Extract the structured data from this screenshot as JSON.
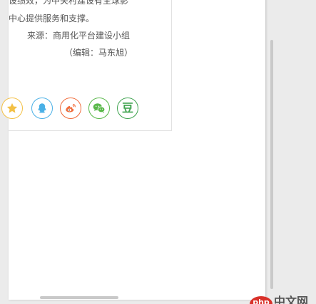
{
  "article": {
    "line1": "设绩效，为中关村建设有全球影",
    "line2": "中心提供服务和支撑。",
    "line3": "来源：商用化平台建设小组",
    "line4": "（编辑：马东旭）"
  },
  "share": {
    "buttons": [
      {
        "icon": "star-icon",
        "color": "#f3c044"
      },
      {
        "icon": "qq-icon",
        "color": "#4ab0e6"
      },
      {
        "icon": "weibo-icon",
        "color": "#f06c3b"
      },
      {
        "icon": "wechat-icon",
        "color": "#59b84a"
      },
      {
        "icon": "douban-icon",
        "color": "#3fa34f",
        "glyph": "豆"
      }
    ]
  },
  "watermark": {
    "badge": "php",
    "text": "中文网"
  }
}
